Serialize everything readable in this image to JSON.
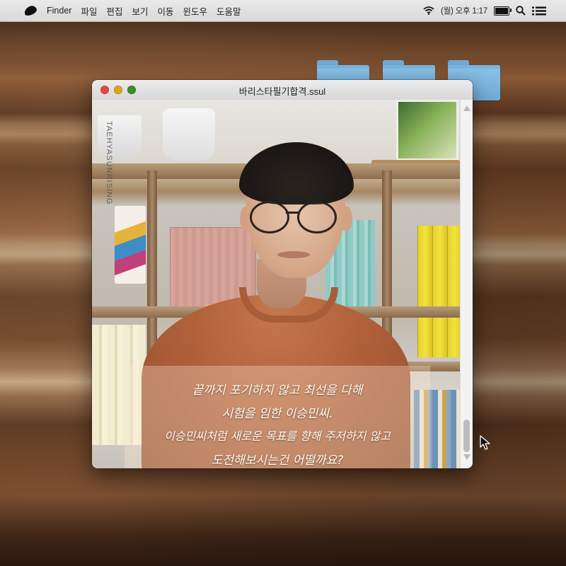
{
  "menubar": {
    "app_name": "Finder",
    "items": [
      "파일",
      "편집",
      "보기",
      "이동",
      "윈도우",
      "도움말"
    ],
    "clock": "(월) 오후 1:17"
  },
  "window": {
    "title": "바리스타필기합격.ssul"
  },
  "photo": {
    "watermark": "TAEHYASUNRISING",
    "caption_lines": [
      "끝까지 포기하지 않고 최선을 다해",
      "시험을 임한 이승민씨.",
      "이승민씨처럼 새로운 목표를 향해 주저하지 않고",
      "도전해보시는건 어떨까요?"
    ]
  },
  "colors": {
    "close": "#e14a3e",
    "minimize": "#d6a421",
    "maximize": "#3f8c2b",
    "folder": "#7fb7e0"
  },
  "icons": [
    "apple-icon",
    "wifi-icon",
    "battery-icon",
    "search-icon",
    "list-icon",
    "folder-icon",
    "cursor-icon"
  ]
}
